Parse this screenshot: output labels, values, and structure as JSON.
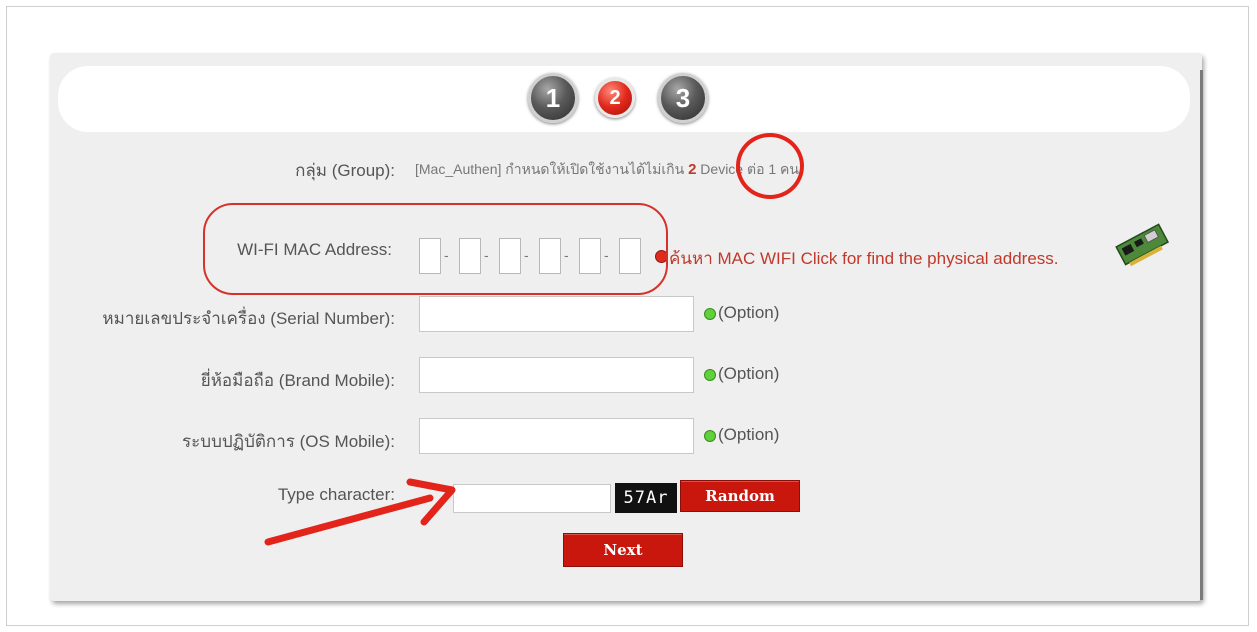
{
  "steps": [
    "1",
    "2",
    "3"
  ],
  "group": {
    "label": "กลุ่ม (Group):",
    "text_prefix": "[Mac_Authen] กำหนดให้เปิดใช้งานได้ไม่เกิน",
    "count": "2",
    "text_suffix": "Device ต่อ 1 คน"
  },
  "mac": {
    "label": "WI-FI MAC Address:",
    "link": "ค้นหา MAC WIFI Click for find the physical address."
  },
  "serial": {
    "label": "หมายเลขประจำเครื่อง (Serial Number):",
    "option": "(Option)"
  },
  "brand": {
    "label": "ยี่ห้อมือถือ (Brand Mobile):",
    "option": "(Option)"
  },
  "os": {
    "label": "ระบบปฏิบัติการ (OS Mobile):",
    "option": "(Option)"
  },
  "captcha": {
    "label": "Type character:",
    "code": "57Ar",
    "random_label": "Random"
  },
  "next_label": "Next",
  "colors": {
    "accent": "#c9170e",
    "option_dot": "#5fd13b"
  },
  "icons": {
    "network_card": "network-card-icon"
  }
}
